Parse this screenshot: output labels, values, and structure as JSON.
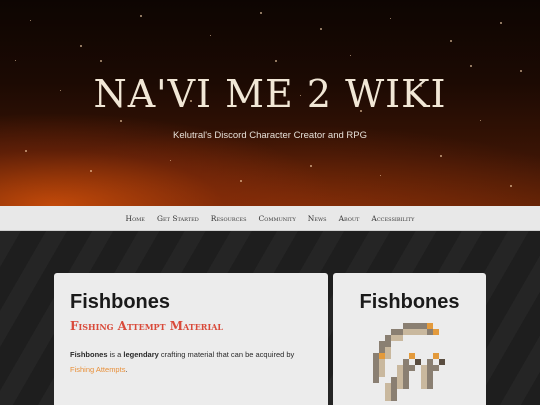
{
  "site": {
    "title": "NA'VI ME 2 WIKI",
    "subtitle": "Kelutral's Discord Character Creator and RPG"
  },
  "nav": {
    "items": [
      "Home",
      "Get Started",
      "Resources",
      "Community",
      "News",
      "About",
      "Accessibility"
    ]
  },
  "article": {
    "title": "Fishbones",
    "subtitle": "Fishing Attempt Material",
    "intro": {
      "name": "Fishbones",
      "text1": " is a ",
      "rarity": "legendary",
      "text2": " crafting material that can be acquired by ",
      "link": "Fishing Attempts",
      "text3": "."
    }
  },
  "infobox": {
    "title": "Fishbones",
    "image_icon": "fishbones-pixel-icon"
  },
  "colors": {
    "accent": "#d94a3a",
    "link": "#e8903a",
    "nav_bg": "#e8e8e8",
    "card_bg": "#ececec"
  }
}
